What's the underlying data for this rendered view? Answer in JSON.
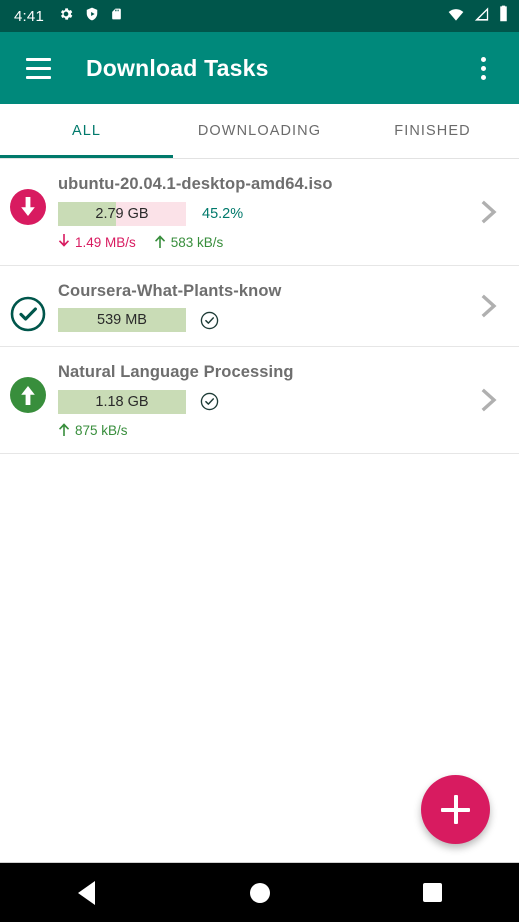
{
  "status_bar": {
    "time": "4:41",
    "left_icons": [
      "gear-icon",
      "shield-play-icon",
      "sd-card-icon"
    ],
    "right_icons": [
      "wifi-icon",
      "cellular-signal-icon",
      "battery-icon"
    ],
    "background_color": "#00564b"
  },
  "app_bar": {
    "title": "Download Tasks",
    "menu_icon": "hamburger-menu-icon",
    "overflow_icon": "overflow-menu-icon",
    "background_color": "#00897b",
    "text_color": "#ffffff"
  },
  "tabs": {
    "active_index": 0,
    "accent_color": "#00796b",
    "items": [
      {
        "label": "ALL"
      },
      {
        "label": "DOWNLOADING"
      },
      {
        "label": "FINISHED"
      }
    ]
  },
  "tasks": [
    {
      "title": "ubuntu-20.04.1-desktop-amd64.iso",
      "status_icon": "download-circle-icon",
      "status_icon_color": "#d81b60",
      "size": "2.79 GB",
      "percent_label": "45.2%",
      "percent_value": 45.2,
      "complete": false,
      "download_speed": "1.49 MB/s",
      "upload_speed": "583 kB/s",
      "chevron_icon": "chevron-right-icon"
    },
    {
      "title": "Coursera-What-Plants-know",
      "status_icon": "check-circle-outline-icon",
      "status_icon_color": "#00564b",
      "size": "539 MB",
      "percent_label": "",
      "percent_value": 100,
      "complete": true,
      "download_speed": "",
      "upload_speed": "",
      "chevron_icon": "chevron-right-icon"
    },
    {
      "title": "Natural Language Processing",
      "status_icon": "upload-circle-icon",
      "status_icon_color": "#388e3c",
      "size": "1.18 GB",
      "percent_label": "",
      "percent_value": 100,
      "complete": true,
      "download_speed": "",
      "upload_speed": "875 kB/s",
      "chevron_icon": "chevron-right-icon"
    }
  ],
  "fab": {
    "label": "+",
    "icon": "plus-icon",
    "color": "#d81b60"
  },
  "nav_bar": {
    "back": "back-triangle-icon",
    "home": "home-circle-icon",
    "recents": "recents-square-icon"
  },
  "colors": {
    "progress_done": "#c9dcb6",
    "progress_remaining": "#fbe2e8",
    "download_speed": "#d81b60",
    "upload_speed": "#388e3c"
  }
}
